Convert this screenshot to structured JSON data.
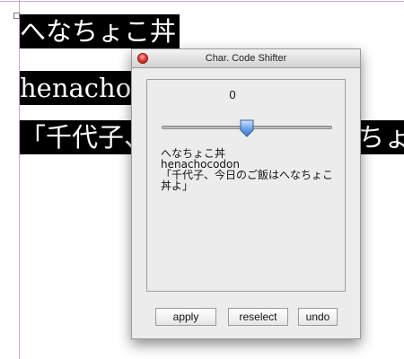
{
  "document": {
    "lines": [
      "へなちょこ丼",
      "henachocodon",
      "「千代子、今日のご飯はへなちょこ丼よ」"
    ]
  },
  "panel": {
    "title": "Char. Code Shifter",
    "slider": {
      "value": "0",
      "position": 0.5
    },
    "preview_lines": [
      "へなちょこ丼",
      "henachocodon",
      "「千代子、今日のご飯はへなちょこ丼よ」"
    ],
    "buttons": {
      "apply": "apply",
      "reselect": "reselect",
      "undo": "undo"
    }
  },
  "colors": {
    "text_highlight": "#000000",
    "close_button": "#e0443a"
  },
  "icons": {
    "close": "close-icon"
  }
}
